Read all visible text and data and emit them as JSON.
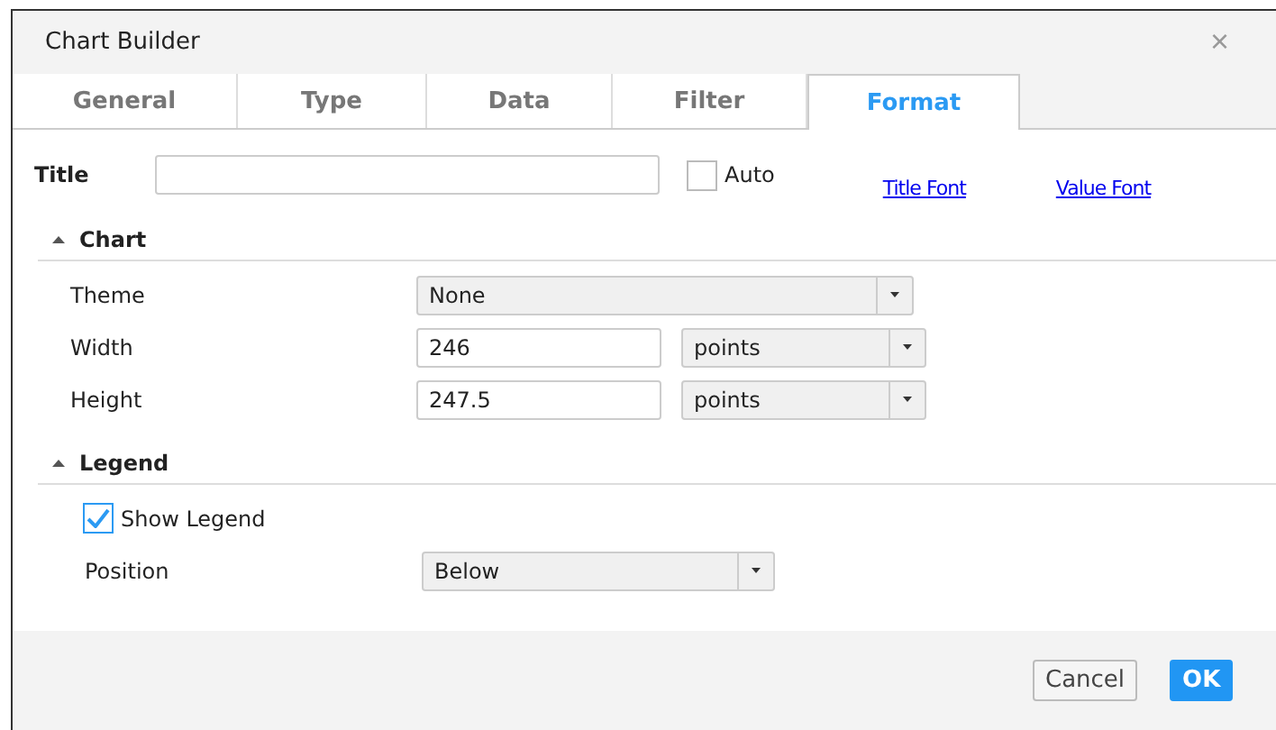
{
  "window": {
    "title": "Chart Builder",
    "close": "×"
  },
  "tabs": [
    {
      "label": "General",
      "selected": false
    },
    {
      "label": "Type",
      "selected": false
    },
    {
      "label": "Data",
      "selected": false
    },
    {
      "label": "Filter",
      "selected": false
    },
    {
      "label": "Format",
      "selected": true
    }
  ],
  "title_row": {
    "label": "Title",
    "auto": {
      "label": "Auto",
      "checked": false
    },
    "links": [
      "Title Font",
      "Value Font"
    ]
  },
  "sections": [
    {
      "title": "Chart",
      "expanded": true,
      "rows": [
        {
          "kind": "select",
          "label": "Theme",
          "value": "None"
        },
        {
          "kind": "size",
          "label": "Width",
          "value": "246",
          "unit": "points"
        },
        {
          "kind": "size",
          "label": "Height",
          "value": "247.5",
          "unit": "points"
        }
      ]
    },
    {
      "title": "Legend",
      "expanded": true,
      "rows": [
        {
          "kind": "checkbox",
          "label": "Show Legend",
          "checked": true
        },
        {
          "kind": "short-select",
          "label": "Position",
          "value": "Below"
        }
      ]
    }
  ],
  "buttons": [
    {
      "label": "Cancel",
      "primary": false
    },
    {
      "label": "OK",
      "primary": true
    }
  ]
}
